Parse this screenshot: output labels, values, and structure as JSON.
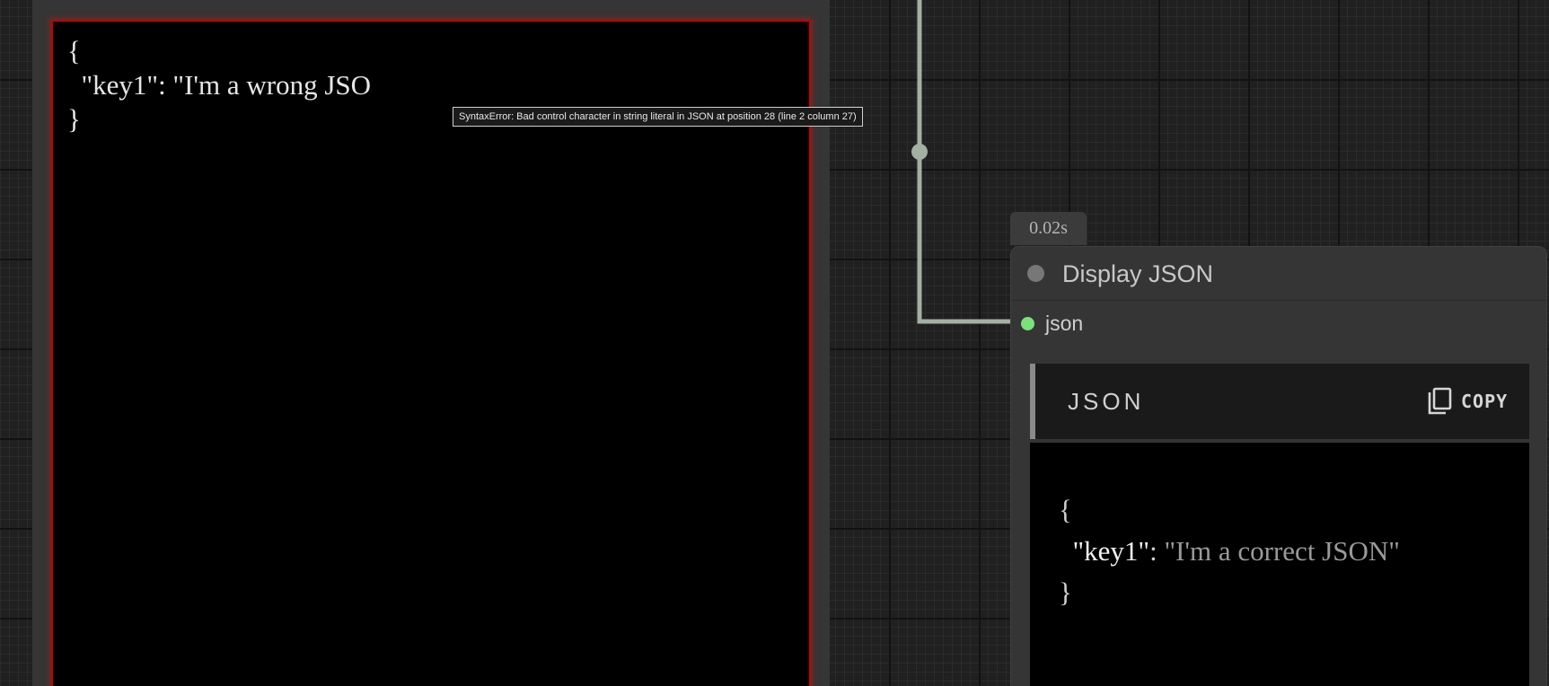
{
  "left_node": {
    "editor_text": "{\n  \"key1\": \"I'm a wrong JSO\n}"
  },
  "tooltip": {
    "text": "SyntaxError: Bad control character in string literal in JSON at position 28 (line 2 column 27)"
  },
  "display_node": {
    "timing": "0.02s",
    "title": "Display JSON",
    "input_label": "json",
    "status_color": "#777777",
    "input_dot_color": "#7be27b",
    "toolbar_label": "JSON",
    "copy_label": "COPY",
    "copy_icon": "copy-icon",
    "code": {
      "open": "{",
      "key": "\"key1\"",
      "colon": ": ",
      "value": "\"I'm a correct JSON\"",
      "close": "}"
    }
  },
  "colors": {
    "error_border": "#a01010",
    "wire": "#a3b0a3"
  }
}
